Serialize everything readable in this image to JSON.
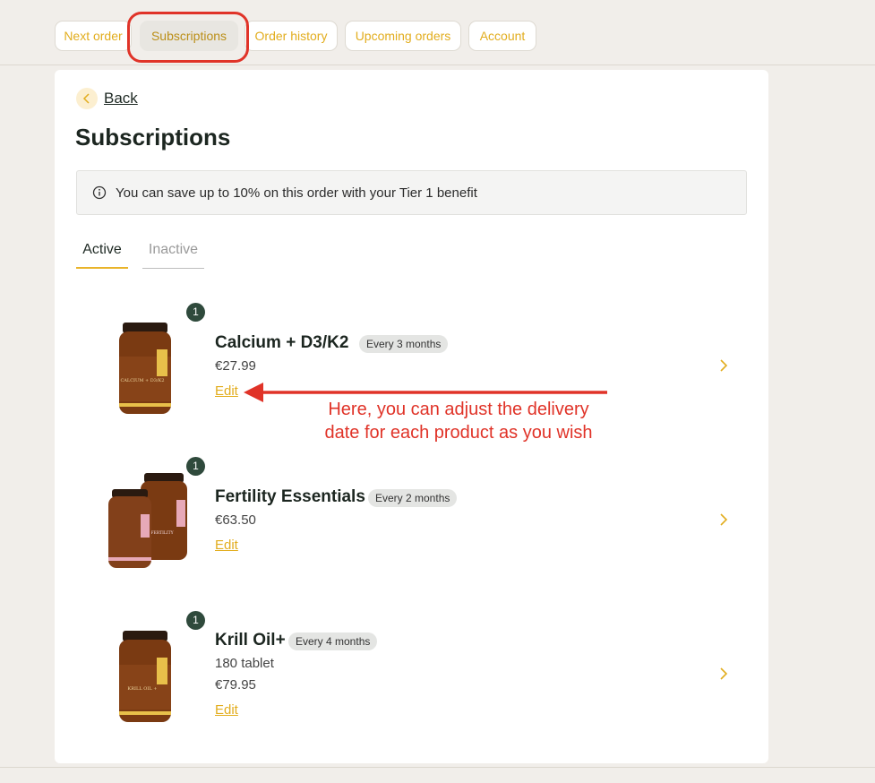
{
  "nav": {
    "items": [
      {
        "label": "Next order"
      },
      {
        "label": "Subscriptions",
        "active": true
      },
      {
        "label": "Order history"
      },
      {
        "label": "Upcoming orders"
      },
      {
        "label": "Account"
      }
    ]
  },
  "back_label": "Back",
  "page_title": "Subscriptions",
  "notice": {
    "icon": "info-icon",
    "text": "You can save up to 10% on this order with your Tier 1 benefit"
  },
  "tabs": {
    "active": "Active",
    "inactive": "Inactive"
  },
  "subscriptions": [
    {
      "name": "Calcium + D3/K2",
      "frequency": "Every 3 months",
      "price": "€27.99",
      "quantity": "1",
      "edit_label": "Edit",
      "image": "single-bottle",
      "label_color": "#e8c04a",
      "bottle_text": "CALCIUM + D3/K2"
    },
    {
      "name": "Fertility Essentials",
      "frequency": "Every 2 months",
      "price": "€63.50",
      "quantity": "1",
      "edit_label": "Edit",
      "image": "two-bottles",
      "label_color": "#e7a9b8",
      "bottle_text": "FERTILITY"
    },
    {
      "name": "Krill Oil+",
      "frequency": "Every 4 months",
      "subtitle": "180 tablet",
      "price": "€79.95",
      "quantity": "1",
      "edit_label": "Edit",
      "image": "single-bottle",
      "label_color": "#e8c04a",
      "bottle_text": "KRILL OIL +"
    }
  ],
  "annotation": {
    "line1": "Here, you can adjust the delivery",
    "line2": "date for each product as you wish",
    "color": "#e03328"
  },
  "colors": {
    "accent": "#e2ad1e",
    "background": "#f1eeea",
    "dark_green": "#2f4a3c"
  }
}
